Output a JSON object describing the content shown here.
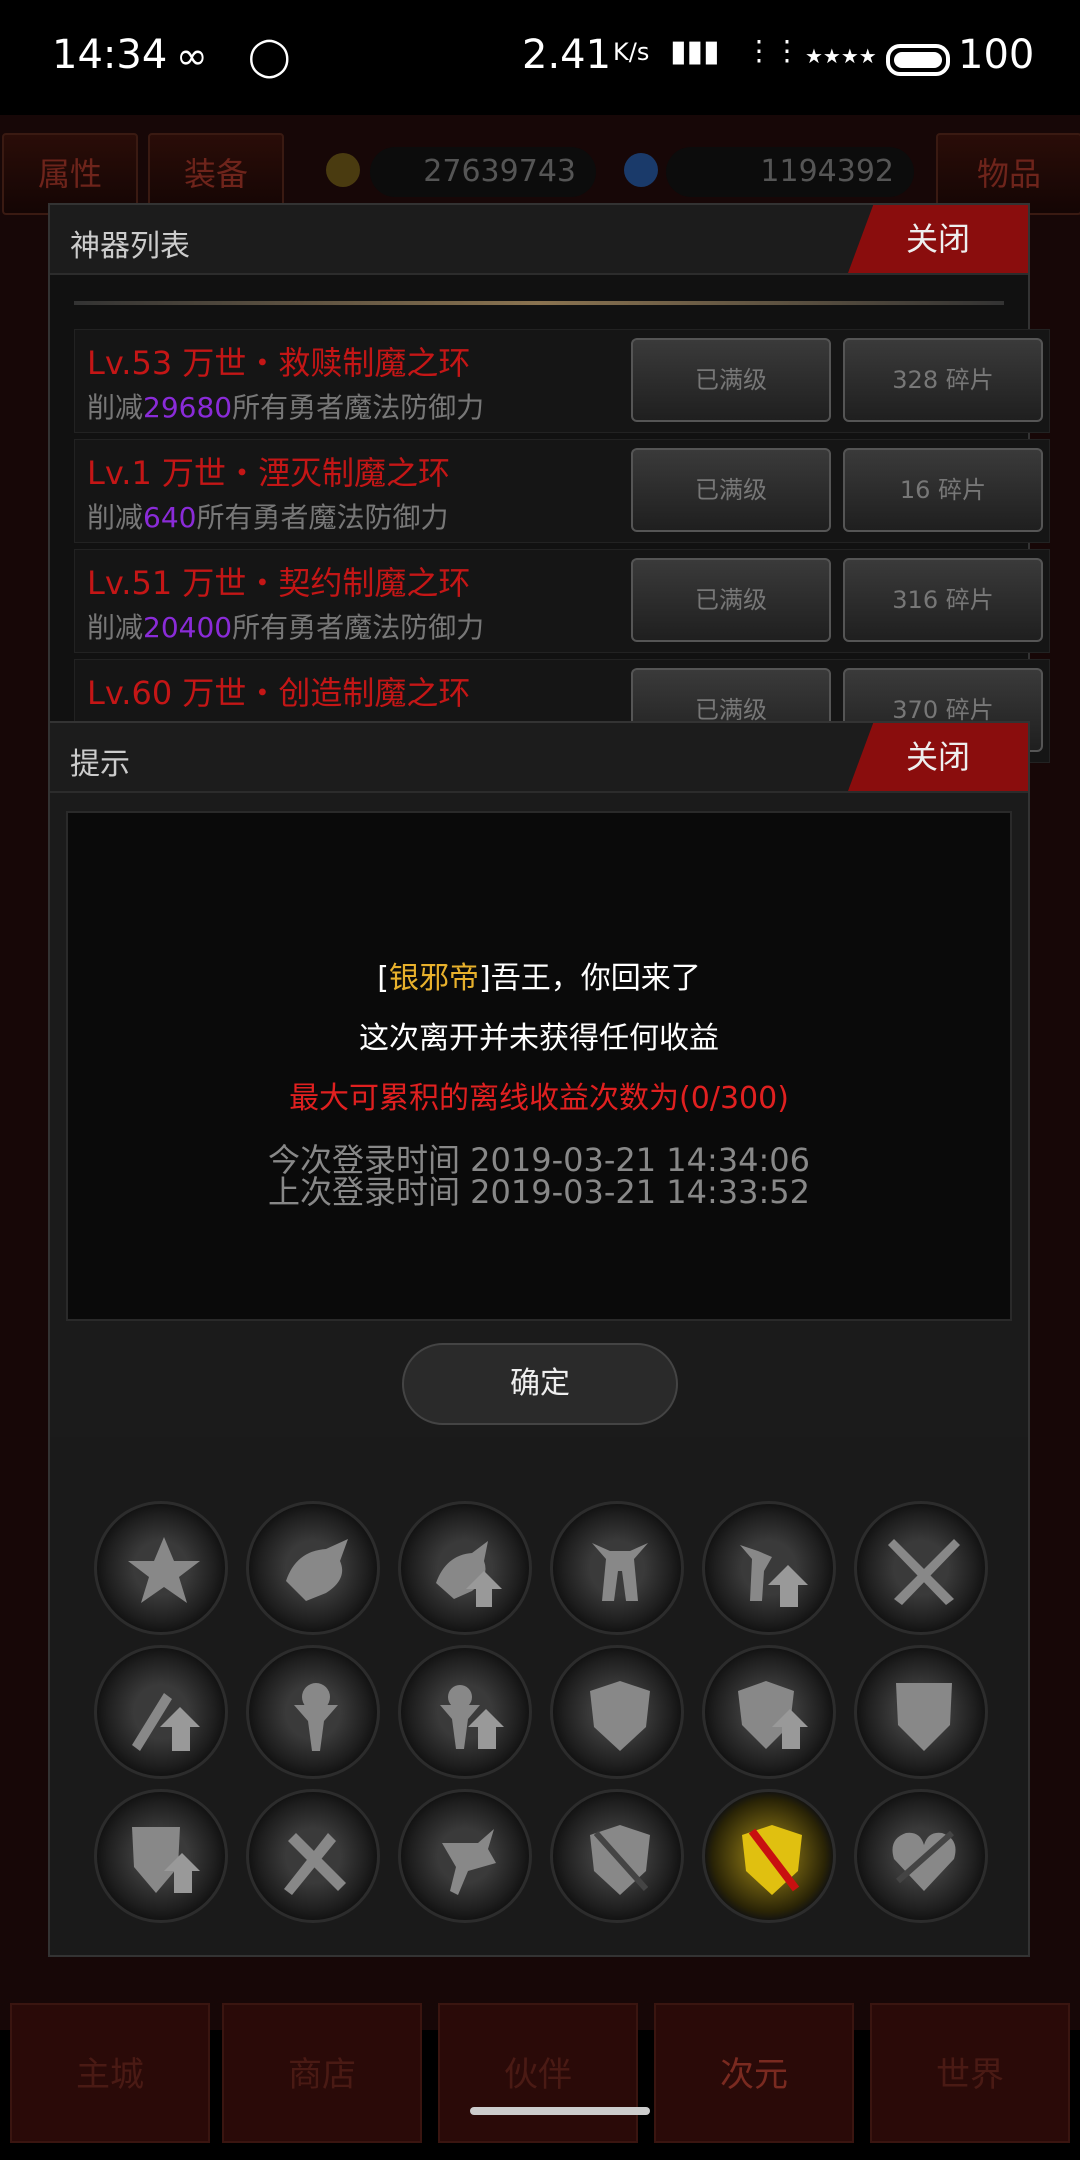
{
  "status_bar": {
    "time": "14:34",
    "speed": "2.41",
    "speed_unit": "K/s",
    "battery": "100"
  },
  "top_bar": {
    "tabs": [
      "属性",
      "装备",
      "物品"
    ],
    "gold": "27639743",
    "diamond": "1194392"
  },
  "artifact_panel": {
    "title": "神器列表",
    "close_label": "关闭",
    "items": [
      {
        "name": "Lv.53 万世・救赎制魔之环",
        "desc_prefix": "削减",
        "value": "29680",
        "desc_suffix": "所有勇者魔法防御力",
        "status": "已满级",
        "shards": "328 碎片"
      },
      {
        "name": "Lv.1 万世・湮灭制魔之环",
        "desc_prefix": "削减",
        "value": "640",
        "desc_suffix": "所有勇者魔法防御力",
        "status": "已满级",
        "shards": "16 碎片"
      },
      {
        "name": "Lv.51 万世・契约制魔之环",
        "desc_prefix": "削减",
        "value": "20400",
        "desc_suffix": "所有勇者魔法防御力",
        "status": "已满级",
        "shards": "316 碎片"
      },
      {
        "name": "Lv.60 万世・创造制魔之环",
        "desc_prefix": "",
        "value": "",
        "desc_suffix": "",
        "status": "已满级",
        "shards": "370 碎片"
      }
    ]
  },
  "dialog": {
    "title": "提示",
    "close_label": "关闭",
    "speaker": "银邪帝",
    "line1_rest": "吾王，你回来了",
    "line2": "这次离开并未获得任何收益",
    "line3": "最大可累积的离线收益次数为(0/300)",
    "login_now": "今次登录时间 2019-03-21 14:34:06",
    "login_last": "上次登录时间 2019-03-21 14:33:52",
    "ok_label": "确定"
  },
  "skills": [
    "star-icon",
    "boar-icon",
    "boar-up-icon",
    "horse-icon",
    "horse-up-icon",
    "crossed-swords-icon",
    "sword-up-icon",
    "totem-icon",
    "totem-up-icon",
    "shield-icon",
    "shield-up-icon",
    "crest-shield-icon",
    "crest-up-icon",
    "sword-break-icon",
    "broken-blade-icon",
    "shield-slash-icon",
    "golden-shield-icon",
    "heart-slash-icon"
  ],
  "bottom_nav": [
    "主城",
    "商店",
    "伙伴",
    "次元",
    "世界"
  ],
  "colors": {
    "accent_red": "#8a0d0d",
    "name_red": "#c41616",
    "value_purple": "#8a2bd8",
    "speaker_gold": "#e8b12c"
  }
}
